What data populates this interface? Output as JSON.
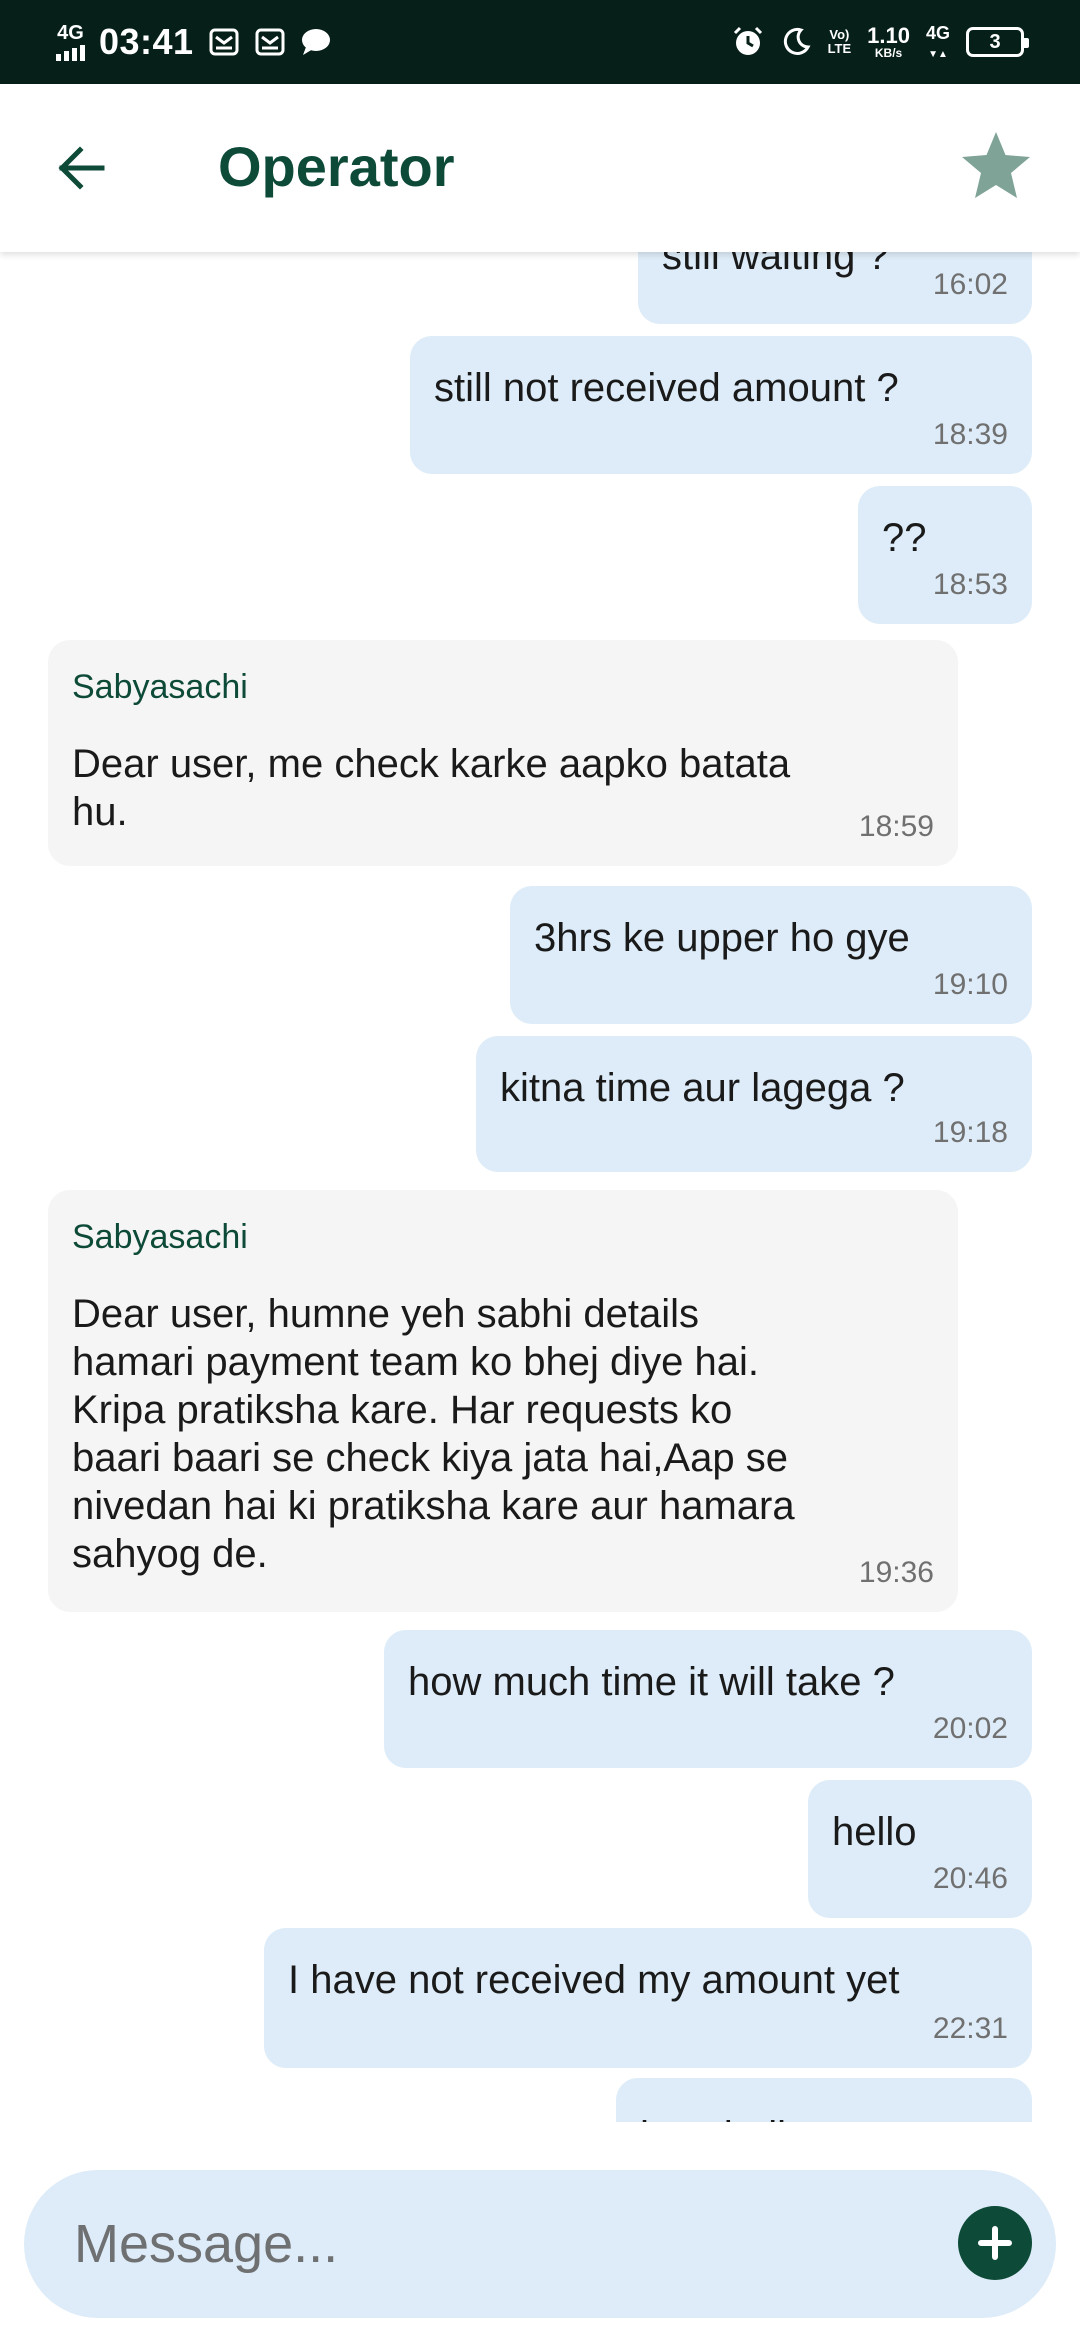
{
  "status_bar": {
    "network": "4G",
    "time": "03:41",
    "speed_value": "1.10",
    "speed_unit": "KB/s",
    "volte": "Vo)\nLTE",
    "signal_type": "4G",
    "battery": "3"
  },
  "header": {
    "title": "Operator",
    "back_icon": "arrow-left-icon",
    "star_icon": "star-icon",
    "star_color": "#7fa396"
  },
  "messages": [
    {
      "dir": "out",
      "text": "…",
      "time": "16:02"
    },
    {
      "dir": "out",
      "text": "still not received amount ?",
      "time": "18:39"
    },
    {
      "dir": "out",
      "text": "??",
      "time": "18:53"
    },
    {
      "dir": "in",
      "sender": "Sabyasachi",
      "text": "Dear user, me check karke aapko batata\nhu.",
      "time": "18:59"
    },
    {
      "dir": "out",
      "text": "3hrs ke upper ho gye",
      "time": "19:10"
    },
    {
      "dir": "out",
      "text": "kitna time aur lagega ?",
      "time": "19:18"
    },
    {
      "dir": "in",
      "sender": "Sabyasachi",
      "text": "Dear user, humne yeh sabhi details\nhamari payment team ko bhej diye hai.\nKripa pratiksha kare. Har requests ko\nbaari baari se check kiya jata hai,Aap se\nnivedan hai ki pratiksha kare aur hamara\nsahyog de.",
      "time": "19:36"
    },
    {
      "dir": "out",
      "text": "how much time it will take ?",
      "time": "20:02"
    },
    {
      "dir": "out",
      "text": "hello",
      "time": "20:46"
    },
    {
      "dir": "out",
      "text": "I have not received my amount yet",
      "time": "22:31"
    },
    {
      "dir": "out",
      "text": "…",
      "time": ""
    }
  ],
  "composer": {
    "placeholder": "Message...",
    "send_icon": "plus-icon",
    "accent": "#0d4a38"
  },
  "colors": {
    "status_bar_bg": "#062019",
    "outgoing_bubble": "#ddecf8",
    "incoming_bubble": "#f5f5f5",
    "sender_name": "#0d4a38"
  }
}
